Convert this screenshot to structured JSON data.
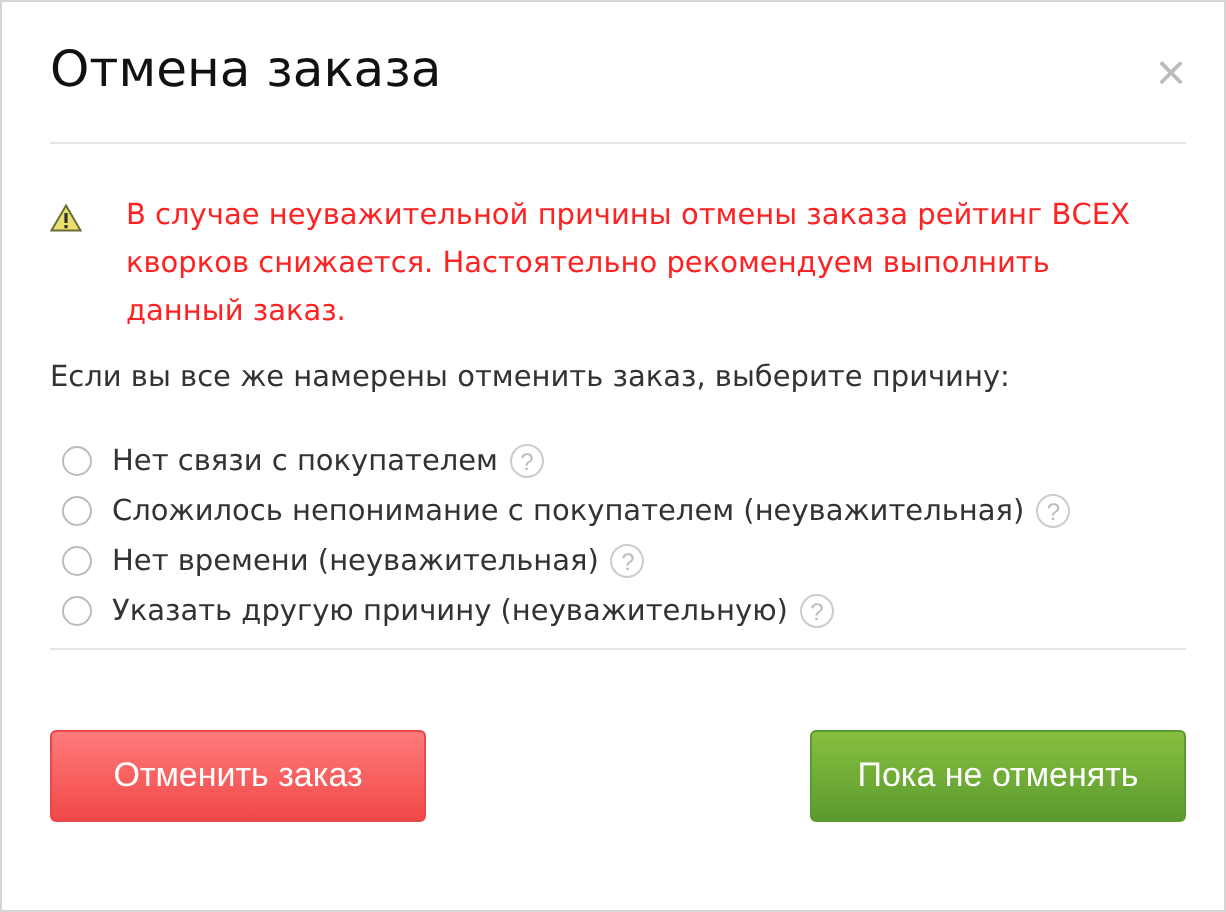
{
  "dialog": {
    "title": "Отмена заказа",
    "close": "×"
  },
  "warning": {
    "text": "В случае неуважительной причины отмены заказа рейтинг ВСЕХ кворков снижается. Настоятельно рекомендуем выполнить данный заказ."
  },
  "prompt": "Если вы все же намерены отменить заказ, выберите причину:",
  "reasons": [
    {
      "label": "Нет связи с покупателем",
      "help": "?",
      "selected": false
    },
    {
      "label": "Сложилось непонимание с покупателем (неуважительная)",
      "help": "?",
      "selected": false
    },
    {
      "label": "Нет времени (неуважительная)",
      "help": "?",
      "selected": false
    },
    {
      "label": "Указать другую причину (неуважительную)",
      "help": "?",
      "selected": false
    }
  ],
  "buttons": [
    {
      "label": "Отменить заказ",
      "kind": "danger"
    },
    {
      "label": "Пока не отменять",
      "kind": "success"
    }
  ]
}
